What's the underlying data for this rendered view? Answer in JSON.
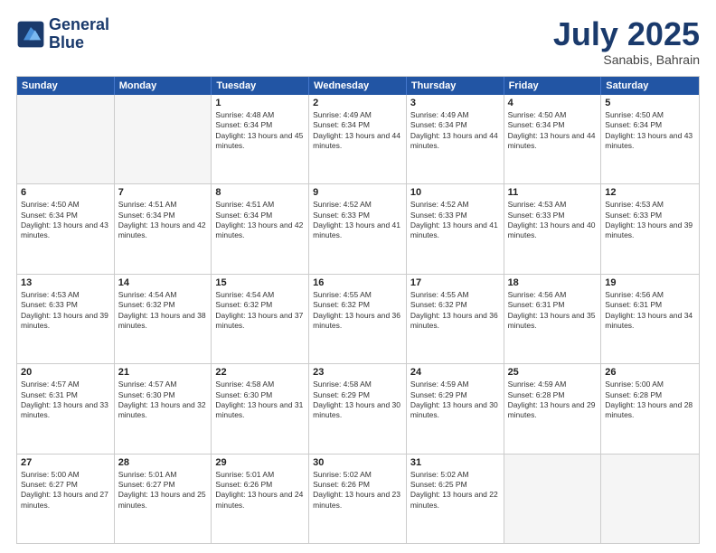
{
  "logo": {
    "line1": "General",
    "line2": "Blue"
  },
  "title": "July 2025",
  "subtitle": "Sanabis, Bahrain",
  "dayHeaders": [
    "Sunday",
    "Monday",
    "Tuesday",
    "Wednesday",
    "Thursday",
    "Friday",
    "Saturday"
  ],
  "weeks": [
    [
      {
        "day": "",
        "info": ""
      },
      {
        "day": "",
        "info": ""
      },
      {
        "day": "1",
        "info": "Sunrise: 4:48 AM\nSunset: 6:34 PM\nDaylight: 13 hours and 45 minutes."
      },
      {
        "day": "2",
        "info": "Sunrise: 4:49 AM\nSunset: 6:34 PM\nDaylight: 13 hours and 44 minutes."
      },
      {
        "day": "3",
        "info": "Sunrise: 4:49 AM\nSunset: 6:34 PM\nDaylight: 13 hours and 44 minutes."
      },
      {
        "day": "4",
        "info": "Sunrise: 4:50 AM\nSunset: 6:34 PM\nDaylight: 13 hours and 44 minutes."
      },
      {
        "day": "5",
        "info": "Sunrise: 4:50 AM\nSunset: 6:34 PM\nDaylight: 13 hours and 43 minutes."
      }
    ],
    [
      {
        "day": "6",
        "info": "Sunrise: 4:50 AM\nSunset: 6:34 PM\nDaylight: 13 hours and 43 minutes."
      },
      {
        "day": "7",
        "info": "Sunrise: 4:51 AM\nSunset: 6:34 PM\nDaylight: 13 hours and 42 minutes."
      },
      {
        "day": "8",
        "info": "Sunrise: 4:51 AM\nSunset: 6:34 PM\nDaylight: 13 hours and 42 minutes."
      },
      {
        "day": "9",
        "info": "Sunrise: 4:52 AM\nSunset: 6:33 PM\nDaylight: 13 hours and 41 minutes."
      },
      {
        "day": "10",
        "info": "Sunrise: 4:52 AM\nSunset: 6:33 PM\nDaylight: 13 hours and 41 minutes."
      },
      {
        "day": "11",
        "info": "Sunrise: 4:53 AM\nSunset: 6:33 PM\nDaylight: 13 hours and 40 minutes."
      },
      {
        "day": "12",
        "info": "Sunrise: 4:53 AM\nSunset: 6:33 PM\nDaylight: 13 hours and 39 minutes."
      }
    ],
    [
      {
        "day": "13",
        "info": "Sunrise: 4:53 AM\nSunset: 6:33 PM\nDaylight: 13 hours and 39 minutes."
      },
      {
        "day": "14",
        "info": "Sunrise: 4:54 AM\nSunset: 6:32 PM\nDaylight: 13 hours and 38 minutes."
      },
      {
        "day": "15",
        "info": "Sunrise: 4:54 AM\nSunset: 6:32 PM\nDaylight: 13 hours and 37 minutes."
      },
      {
        "day": "16",
        "info": "Sunrise: 4:55 AM\nSunset: 6:32 PM\nDaylight: 13 hours and 36 minutes."
      },
      {
        "day": "17",
        "info": "Sunrise: 4:55 AM\nSunset: 6:32 PM\nDaylight: 13 hours and 36 minutes."
      },
      {
        "day": "18",
        "info": "Sunrise: 4:56 AM\nSunset: 6:31 PM\nDaylight: 13 hours and 35 minutes."
      },
      {
        "day": "19",
        "info": "Sunrise: 4:56 AM\nSunset: 6:31 PM\nDaylight: 13 hours and 34 minutes."
      }
    ],
    [
      {
        "day": "20",
        "info": "Sunrise: 4:57 AM\nSunset: 6:31 PM\nDaylight: 13 hours and 33 minutes."
      },
      {
        "day": "21",
        "info": "Sunrise: 4:57 AM\nSunset: 6:30 PM\nDaylight: 13 hours and 32 minutes."
      },
      {
        "day": "22",
        "info": "Sunrise: 4:58 AM\nSunset: 6:30 PM\nDaylight: 13 hours and 31 minutes."
      },
      {
        "day": "23",
        "info": "Sunrise: 4:58 AM\nSunset: 6:29 PM\nDaylight: 13 hours and 30 minutes."
      },
      {
        "day": "24",
        "info": "Sunrise: 4:59 AM\nSunset: 6:29 PM\nDaylight: 13 hours and 30 minutes."
      },
      {
        "day": "25",
        "info": "Sunrise: 4:59 AM\nSunset: 6:28 PM\nDaylight: 13 hours and 29 minutes."
      },
      {
        "day": "26",
        "info": "Sunrise: 5:00 AM\nSunset: 6:28 PM\nDaylight: 13 hours and 28 minutes."
      }
    ],
    [
      {
        "day": "27",
        "info": "Sunrise: 5:00 AM\nSunset: 6:27 PM\nDaylight: 13 hours and 27 minutes."
      },
      {
        "day": "28",
        "info": "Sunrise: 5:01 AM\nSunset: 6:27 PM\nDaylight: 13 hours and 25 minutes."
      },
      {
        "day": "29",
        "info": "Sunrise: 5:01 AM\nSunset: 6:26 PM\nDaylight: 13 hours and 24 minutes."
      },
      {
        "day": "30",
        "info": "Sunrise: 5:02 AM\nSunset: 6:26 PM\nDaylight: 13 hours and 23 minutes."
      },
      {
        "day": "31",
        "info": "Sunrise: 5:02 AM\nSunset: 6:25 PM\nDaylight: 13 hours and 22 minutes."
      },
      {
        "day": "",
        "info": ""
      },
      {
        "day": "",
        "info": ""
      }
    ]
  ]
}
